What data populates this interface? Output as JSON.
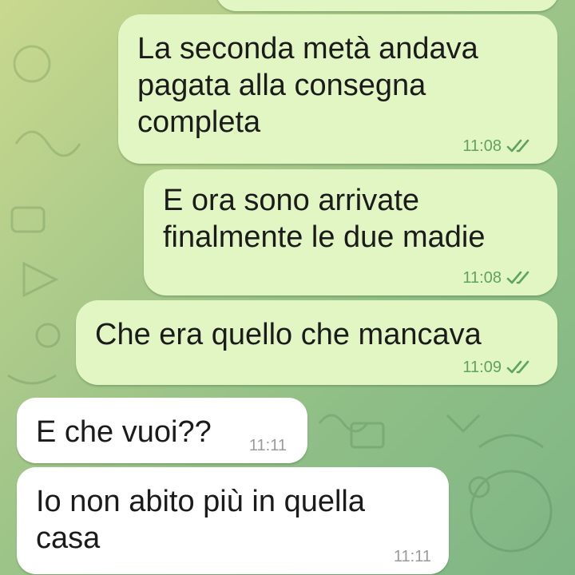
{
  "chat": {
    "messages": [
      {
        "text": "La seconda metà andava pagata alla consegna completa",
        "time": "11:08",
        "direction": "outgoing",
        "status": "read"
      },
      {
        "text": "E ora sono arrivate finalmente le due madie",
        "time": "11:08",
        "direction": "outgoing",
        "status": "read"
      },
      {
        "text": "Che era quello che mancava",
        "time": "11:09",
        "direction": "outgoing",
        "status": "read"
      },
      {
        "text": "E che vuoi??",
        "time": "11:11",
        "direction": "incoming"
      },
      {
        "text": "Io non abito più in quella casa",
        "time": "11:11",
        "direction": "incoming"
      }
    ]
  },
  "colors": {
    "outgoing_bubble": "#e2f6c4",
    "incoming_bubble": "#ffffff",
    "read_ticks": "#5fa35d",
    "background_top": "#c9d98e",
    "background_bottom": "#7fb585"
  },
  "icons": {
    "read_status": "double-check-icon"
  }
}
